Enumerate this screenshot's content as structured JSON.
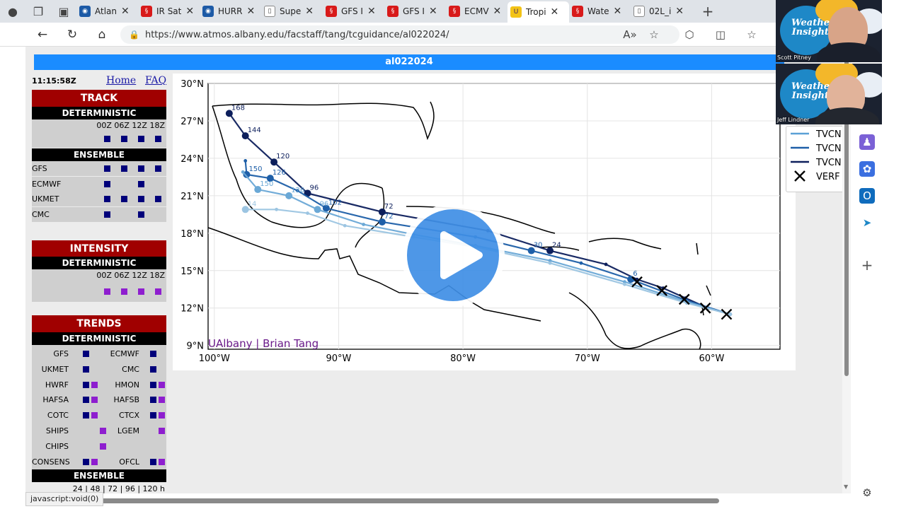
{
  "browser": {
    "tabs": [
      {
        "label": "Atlan",
        "icon": "noaa-icon"
      },
      {
        "label": "IR Sat",
        "icon": "hurricane-icon"
      },
      {
        "label": "HURR",
        "icon": "noaa-icon"
      },
      {
        "label": "Supe",
        "icon": "page-icon"
      },
      {
        "label": "GFS I",
        "icon": "hurricane-icon"
      },
      {
        "label": "GFS I",
        "icon": "hurricane-icon"
      },
      {
        "label": "ECMV",
        "icon": "hurricane-icon"
      },
      {
        "label": "Tropi",
        "icon": "ualbany-icon",
        "active": true
      },
      {
        "label": "Wate",
        "icon": "hurricane-icon"
      },
      {
        "label": "02L_i",
        "icon": "page-icon"
      }
    ],
    "url": "https://www.atmos.albany.edu/facstaff/tang/tcguidance/al022024/",
    "status_text": "javascript:void(0)"
  },
  "page": {
    "title": "al022024",
    "time": "11:15:58Z",
    "home_link": "Home",
    "faq_link": "FAQ",
    "track": {
      "header": "TRACK",
      "deterministic": "DETERMINISTIC",
      "hours": "00Z 06Z 12Z 18Z",
      "ensemble": "ENSEMBLE",
      "models": [
        "GFS",
        "ECMWF",
        "UKMET",
        "CMC"
      ]
    },
    "intensity": {
      "header": "INTENSITY",
      "deterministic": "DETERMINISTIC",
      "hours": "00Z 06Z 12Z 18Z"
    },
    "trends": {
      "header": "TRENDS",
      "deterministic": "DETERMINISTIC",
      "left": [
        "GFS",
        "UKMET",
        "HWRF",
        "HAFSA",
        "COTC",
        "SHIPS",
        "CHIPS",
        "CONSENS"
      ],
      "right": [
        "ECMWF",
        "CMC",
        "HMON",
        "HAFSB",
        "CTCX",
        "LGEM",
        "",
        "OFCL"
      ],
      "ensemble": "ENSEMBLE",
      "lead_times": "24 | 48 | 72 | 96 | 120 h"
    }
  },
  "chart_data": {
    "type": "line",
    "title": "",
    "xlabel": "",
    "ylabel": "",
    "x_ticks": [
      "100°W",
      "90°W",
      "80°W",
      "70°W",
      "60°W"
    ],
    "y_ticks": [
      "30°N",
      "27°N",
      "24°N",
      "21°N",
      "18°N",
      "15°N",
      "12°N",
      "9°N"
    ],
    "xlim": [
      -100.5,
      -54.5
    ],
    "ylim": [
      8.7,
      30
    ],
    "grid": true,
    "legend_position": "top-right",
    "legend": [
      "TVCN",
      "TVCN",
      "TVCN",
      "VERF"
    ],
    "credit": "UAlbany | Brian Tang",
    "series": [
      {
        "name": "TVCN",
        "color": "#0d1f5c",
        "lon": [
          -58.5,
          -60.3,
          -62.1,
          -63.9,
          -66,
          -68.5,
          -73,
          -78,
          -86.5,
          -92.5,
          -95.2,
          -97.5,
          -98.8
        ],
        "lat": [
          11.5,
          12,
          12.8,
          13.6,
          14.3,
          15.5,
          16.6,
          18.2,
          19.7,
          21.2,
          23.7,
          25.8,
          27.6
        ],
        "labels": [
          "",
          "",
          "",
          "",
          "",
          "",
          "24",
          "",
          "72",
          "96",
          "120",
          "144",
          "168"
        ]
      },
      {
        "name": "TVCN",
        "color": "#1e5fa8",
        "lon": [
          -58.5,
          -62,
          -66.5,
          -70.5,
          -74.5,
          -79,
          -86.5,
          -91,
          -93.3,
          -95.5,
          -97.4,
          -97.5
        ],
        "lat": [
          11.5,
          12.6,
          14.3,
          15.6,
          16.6,
          17.7,
          18.9,
          20,
          21.4,
          22.4,
          22.7,
          23.8
        ],
        "labels": [
          "",
          "",
          "6",
          "",
          "30",
          "",
          "72",
          "102",
          "",
          "126",
          "150",
          ""
        ]
      },
      {
        "name": "TVCN",
        "color": "#6aa8d6",
        "lon": [
          -58.5,
          -62,
          -67,
          -73,
          -79,
          -84,
          -88,
          -91.7,
          -94,
          -96.5,
          -97.7
        ],
        "lat": [
          11.5,
          12.5,
          14.1,
          15.8,
          17,
          17.9,
          18.7,
          19.9,
          21,
          21.5,
          22.9
        ],
        "labels": [
          "",
          "",
          "",
          "",
          "",
          "",
          "",
          "96",
          "126",
          "150",
          ""
        ]
      },
      {
        "name": "TVCN",
        "color": "#9cc5e2",
        "lon": [
          -58.5,
          -62,
          -67,
          -73,
          -79,
          -84,
          -89.5,
          -92.5,
          -95,
          -97.5
        ],
        "lat": [
          11.5,
          12.4,
          13.9,
          15.6,
          16.9,
          17.7,
          18.6,
          19.6,
          19.9,
          19.9
        ],
        "labels": [
          "",
          "",
          "",
          "",
          "",
          "",
          "",
          "",
          "",
          "14"
        ]
      },
      {
        "name": "VERF",
        "color": "#000000",
        "marker": "x",
        "lon": [
          -58.8,
          -60.5,
          -62.2,
          -64,
          -66
        ],
        "lat": [
          11.5,
          12,
          12.7,
          13.4,
          14.1
        ]
      }
    ]
  },
  "video": {
    "person1": "Scott Pitney",
    "person2": "Jeff Lindner",
    "logo": "Weather Insights"
  },
  "colors": {
    "accent": "#1a8cff",
    "section_red": "#a00000",
    "navy": "#00007a",
    "purple": "#8e1ecf"
  }
}
